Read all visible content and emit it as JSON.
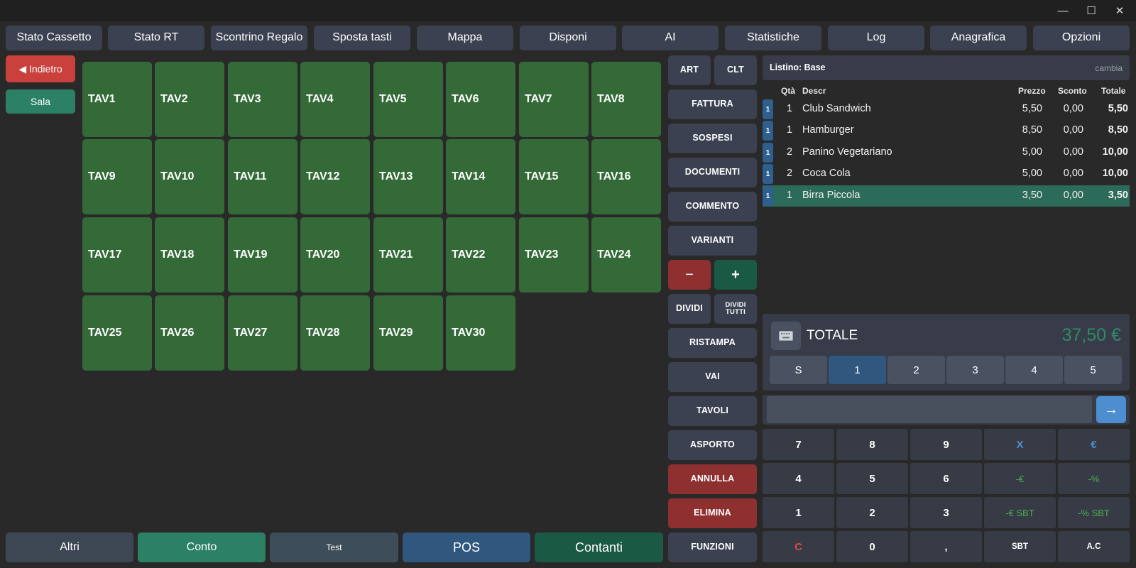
{
  "window": {
    "minimize": "—",
    "maximize": "☐",
    "close": "✕"
  },
  "top_menu": [
    "Stato Cassetto",
    "Stato RT",
    "Scontrino Regalo",
    "Sposta tasti",
    "Mappa",
    "Disponi",
    "AI",
    "Statistiche",
    "Log",
    "Anagrafica",
    "Opzioni"
  ],
  "left_nav": {
    "back": "◀ Indietro",
    "room": "Sala"
  },
  "tables": [
    "TAV1",
    "TAV2",
    "TAV3",
    "TAV4",
    "TAV5",
    "TAV6",
    "TAV7",
    "TAV8",
    "TAV9",
    "TAV10",
    "TAV11",
    "TAV12",
    "TAV13",
    "TAV14",
    "TAV15",
    "TAV16",
    "TAV17",
    "TAV18",
    "TAV19",
    "TAV20",
    "TAV21",
    "TAV22",
    "TAV23",
    "TAV24",
    "TAV25",
    "TAV26",
    "TAV27",
    "TAV28",
    "TAV29",
    "TAV30"
  ],
  "actions": {
    "art": "ART",
    "clt": "CLT",
    "fattura": "FATTURA",
    "sospesi": "SOSPESI",
    "documenti": "DOCUMENTI",
    "commento": "COMMENTO",
    "varianti": "VARIANTI",
    "minus": "−",
    "plus": "+",
    "dividi": "DIVIDI",
    "dividi_tutti": "DIVIDI TUTTI",
    "ristampa": "RISTAMPA",
    "vai": "VAI",
    "tavoli": "TAVOLI",
    "asporto": "ASPORTO",
    "annulla": "ANNULLA",
    "elimina": "ELIMINA",
    "funzioni": "FUNZIONI"
  },
  "bottom": {
    "altri": "Altri",
    "conto": "Conto",
    "test": "Test",
    "pos": "POS",
    "contanti": "Contanti"
  },
  "receipt": {
    "listino_label": "Listino: Base",
    "change": "cambia",
    "headers": {
      "qty": "Qtà",
      "descr": "Descr",
      "prezzo": "Prezzo",
      "sconto": "Sconto",
      "totale": "Totale"
    },
    "rows": [
      {
        "badge": "1",
        "qty": "1",
        "descr": "Club Sandwich",
        "prezzo": "5,50",
        "sconto": "0,00",
        "totale": "5,50"
      },
      {
        "badge": "1",
        "qty": "1",
        "descr": "Hamburger",
        "prezzo": "8,50",
        "sconto": "0,00",
        "totale": "8,50"
      },
      {
        "badge": "1",
        "qty": "2",
        "descr": "Panino Vegetariano",
        "prezzo": "5,00",
        "sconto": "0,00",
        "totale": "10,00"
      },
      {
        "badge": "1",
        "qty": "2",
        "descr": "Coca Cola",
        "prezzo": "5,00",
        "sconto": "0,00",
        "totale": "10,00"
      },
      {
        "badge": "1",
        "qty": "1",
        "descr": "Birra Piccola",
        "prezzo": "3,50",
        "sconto": "0,00",
        "totale": "3,50"
      }
    ],
    "selected_row": 4
  },
  "total": {
    "label": "TOTALE",
    "amount": "37,50 €",
    "amount_color": "#2e8b68"
  },
  "counters": [
    "S",
    "1",
    "2",
    "3",
    "4",
    "5"
  ],
  "selected_counter": 1,
  "input": {
    "value": "",
    "go": "→"
  },
  "keypad": [
    [
      "7",
      "8",
      "9",
      "X",
      "€"
    ],
    [
      "4",
      "5",
      "6",
      "-€",
      "-%"
    ],
    [
      "1",
      "2",
      "3",
      "-€ SBT",
      "-% SBT"
    ],
    [
      "C",
      "0",
      ",",
      "SBT",
      "A.C"
    ]
  ],
  "colors": {
    "green_tile": "#336a37",
    "danger": "#8e302f",
    "teal": "#2b8066",
    "blue": "#30587f",
    "dark_green": "#1a5943",
    "accent_blue": "#4d8ed1",
    "discount_green": "#4caf50"
  }
}
